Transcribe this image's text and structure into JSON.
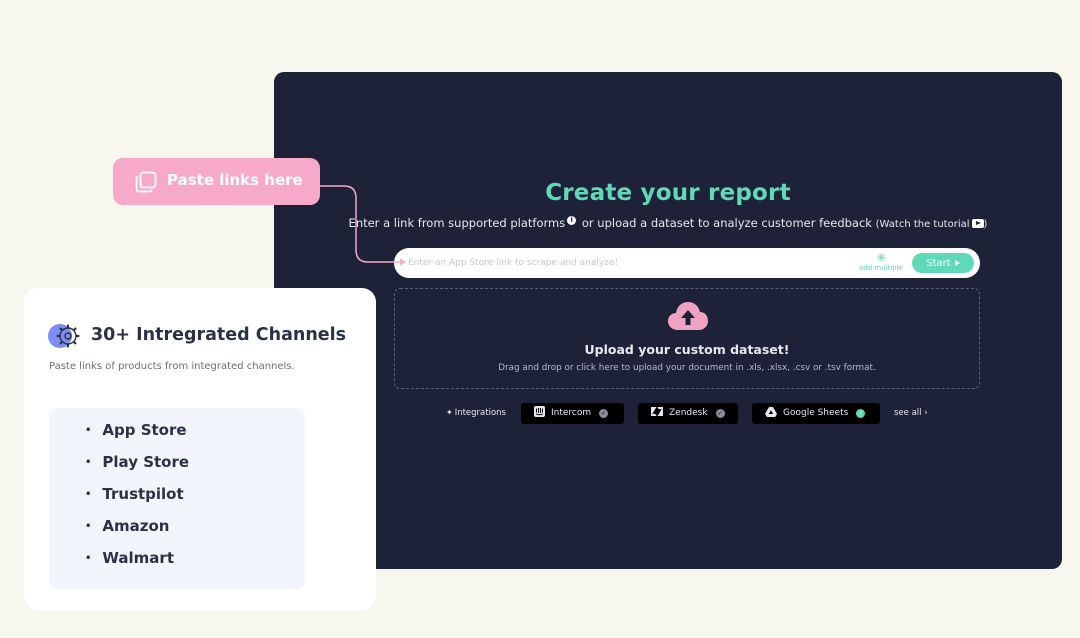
{
  "report": {
    "title": "Create your report",
    "subtitle_part1": "Enter a link from supported platforms",
    "subtitle_part2": "or upload a dataset to analyze customer feedback",
    "tutorial_text": "(Watch the tutorial",
    "tutorial_close": ")"
  },
  "link_bar": {
    "placeholder": "Enter an App Store link to scrape and analyze!",
    "add_multiple": "add multiple",
    "start_label": "Start"
  },
  "upload": {
    "title": "Upload your custom dataset!",
    "description": "Drag and drop or click here to upload your document in .xls, .xlsx, .csv or .tsv format."
  },
  "integrations": {
    "label": "Integrations",
    "items": [
      {
        "name": "Intercom",
        "icon": "intercom-icon",
        "connected": false
      },
      {
        "name": "Zendesk",
        "icon": "zendesk-icon",
        "connected": false
      },
      {
        "name": "Google Sheets",
        "icon": "google-drive-icon",
        "connected": true
      }
    ],
    "see_all": "see all"
  },
  "callout": {
    "label": "Paste links here"
  },
  "channels_card": {
    "title": "30+ Intregrated Channels",
    "description": "Paste links of products from integrated channels.",
    "channels": [
      "App Store",
      "Play Store",
      "Trustpilot",
      "Amazon",
      "Walmart"
    ]
  },
  "colors": {
    "panel_bg": "#1e2238",
    "accent_teal": "#5fd9b8",
    "pink": "#f6a9c8",
    "page_bg": "#f7f6ef"
  }
}
